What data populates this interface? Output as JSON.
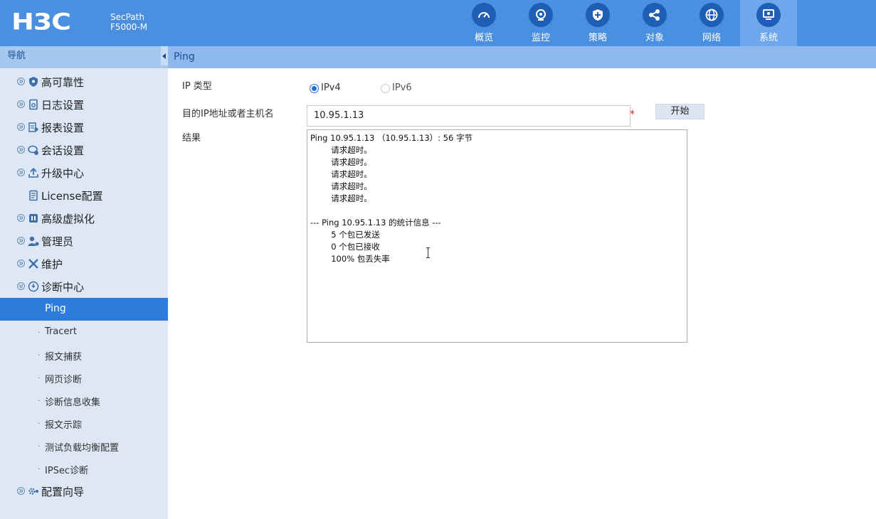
{
  "brand": {
    "logo_text": "H3C",
    "product_line1": "SecPath",
    "product_line2": "F5000-M"
  },
  "nav_tabs": [
    {
      "label": "概览",
      "icon": "dashboard-icon"
    },
    {
      "label": "监控",
      "icon": "monitor-icon"
    },
    {
      "label": "策略",
      "icon": "shield-plus-icon"
    },
    {
      "label": "对象",
      "icon": "share-icon"
    },
    {
      "label": "网络",
      "icon": "globe-icon"
    },
    {
      "label": "系统",
      "icon": "system-icon",
      "active": true
    }
  ],
  "sidebar": {
    "title": "导航",
    "items": [
      {
        "label": "高可靠性",
        "icon": "shield-icon"
      },
      {
        "label": "日志设置",
        "icon": "log-icon"
      },
      {
        "label": "报表设置",
        "icon": "report-icon"
      },
      {
        "label": "会话设置",
        "icon": "session-icon"
      },
      {
        "label": "升级中心",
        "icon": "upload-icon"
      },
      {
        "label": "License配置",
        "icon": "license-icon"
      },
      {
        "label": "高级虚拟化",
        "icon": "virtualization-icon"
      },
      {
        "label": "管理员",
        "icon": "admin-icon"
      },
      {
        "label": "维护",
        "icon": "tools-icon"
      },
      {
        "label": "诊断中心",
        "icon": "diagnose-icon"
      }
    ],
    "sub_items": [
      {
        "label": "Ping",
        "active": true
      },
      {
        "label": "Tracert"
      },
      {
        "label": "报文捕获"
      },
      {
        "label": "网页诊断"
      },
      {
        "label": "诊断信息收集"
      },
      {
        "label": "报文示踪"
      },
      {
        "label": "测试负载均衡配置"
      },
      {
        "label": "IPSec诊断"
      }
    ],
    "last_item": {
      "label": "配置向导",
      "icon": "wizard-icon"
    }
  },
  "page": {
    "title": "Ping",
    "ip_type_label": "IP 类型",
    "ipv4_label": "IPv4",
    "ipv6_label": "IPv6",
    "ip_type_selected": "IPv4",
    "dest_label": "目的IP地址或者主机名",
    "dest_value": "10.95.1.13",
    "required_mark": "*",
    "start_button": "开始",
    "result_label": "结果",
    "result_lines": [
      "Ping 10.95.1.13 （10.95.1.13）: 56 字节",
      "        请求超时。",
      "        请求超时。",
      "        请求超时。",
      "        请求超时。",
      "        请求超时。",
      "",
      "--- Ping 10.95.1.13 的统计信息 ---",
      "        5 个包已发送",
      "        0 个包已接收",
      "        100% 包丢失率"
    ]
  },
  "colors": {
    "header": "#4a8fe0",
    "active_tab": "#6ea7eb",
    "sidebar": "#dde7f5",
    "active_item": "#2f7bdb",
    "required": "#e02020"
  }
}
